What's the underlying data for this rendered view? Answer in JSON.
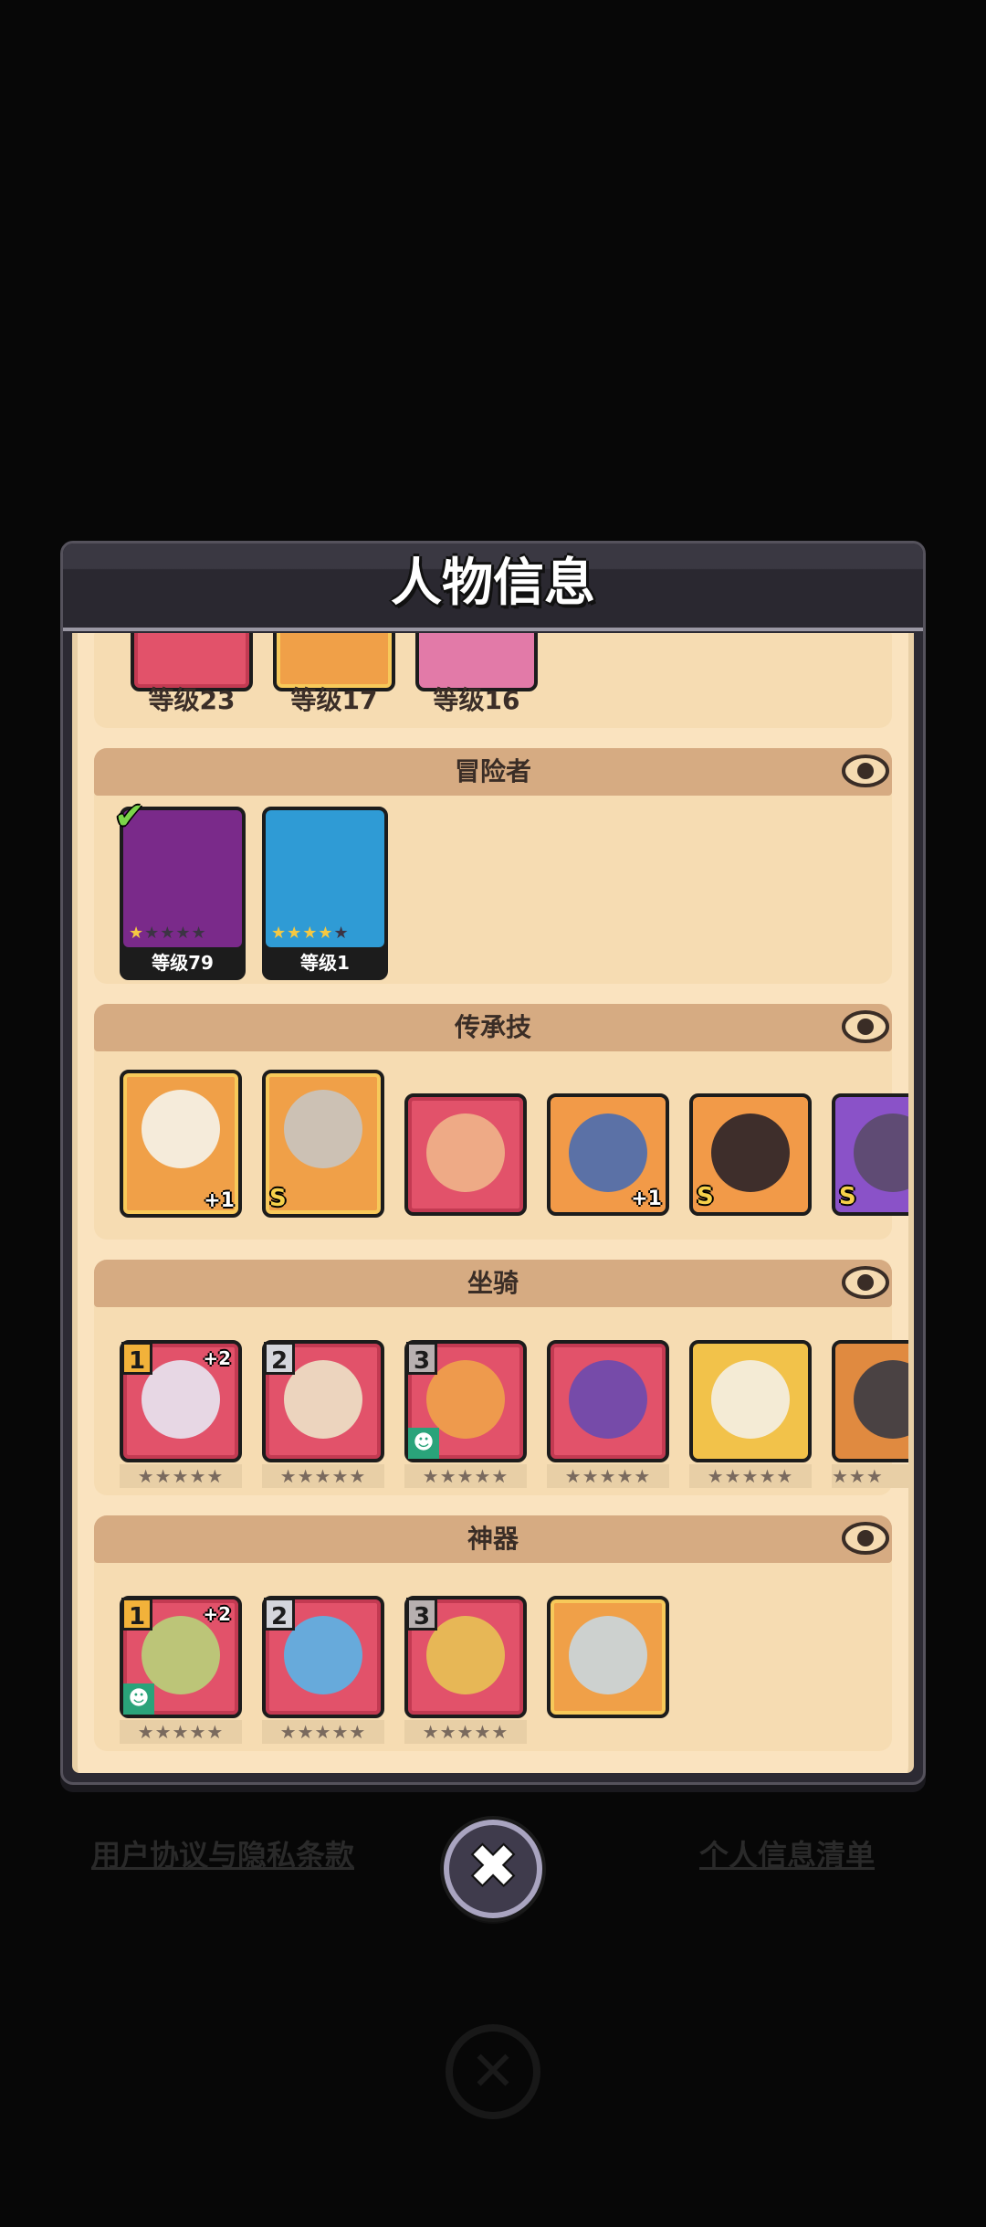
{
  "dialog": {
    "title": "人物信息"
  },
  "pets_top": {
    "levels": [
      "等级23",
      "等级17",
      "等级16"
    ]
  },
  "adventurer": {
    "title": "冒险者",
    "cards": [
      {
        "level": "等级79",
        "stars": 1,
        "max_stars": 5,
        "selected": true,
        "color": "#7a2a8a"
      },
      {
        "level": "等级1",
        "stars": 4,
        "max_stars": 5,
        "selected": false,
        "color": "#2f9bd5"
      }
    ]
  },
  "legacy": {
    "title": "传承技",
    "items": [
      {
        "badge": "+1"
      },
      {
        "badge": "S"
      },
      {
        "badge": ""
      },
      {
        "badge": "+1"
      },
      {
        "badge": "S"
      },
      {
        "badge": "S"
      }
    ]
  },
  "mounts": {
    "title": "坐骑",
    "items": [
      {
        "slot": "1",
        "plus": "+2",
        "stars": "★★★★★"
      },
      {
        "slot": "2",
        "plus": "",
        "stars": "★★★★★"
      },
      {
        "slot": "3",
        "plus": "",
        "stars": "★★★★★"
      },
      {
        "slot": "",
        "plus": "",
        "stars": "★★★★★"
      },
      {
        "slot": "",
        "plus": "",
        "stars": "★★★★★"
      },
      {
        "slot": "",
        "plus": "",
        "stars": "★★★"
      }
    ]
  },
  "artifacts": {
    "title": "神器",
    "items": [
      {
        "slot": "1",
        "plus": "+2",
        "stars": "★★★★★"
      },
      {
        "slot": "2",
        "plus": "",
        "stars": "★★★★★"
      },
      {
        "slot": "3",
        "plus": "",
        "stars": "★★★★★"
      },
      {
        "slot": "",
        "plus": "",
        "stars": ""
      }
    ]
  },
  "footer": {
    "left_link": "用户协议与隐私条款",
    "right_link": "个人信息清单"
  },
  "colors": {
    "panel": "#2c2a33",
    "content_bg": "#fae3bf",
    "section_header": "#d6ab82"
  },
  "icons": {
    "close": "close-icon",
    "eye": "eye-icon",
    "check": "check-icon"
  }
}
